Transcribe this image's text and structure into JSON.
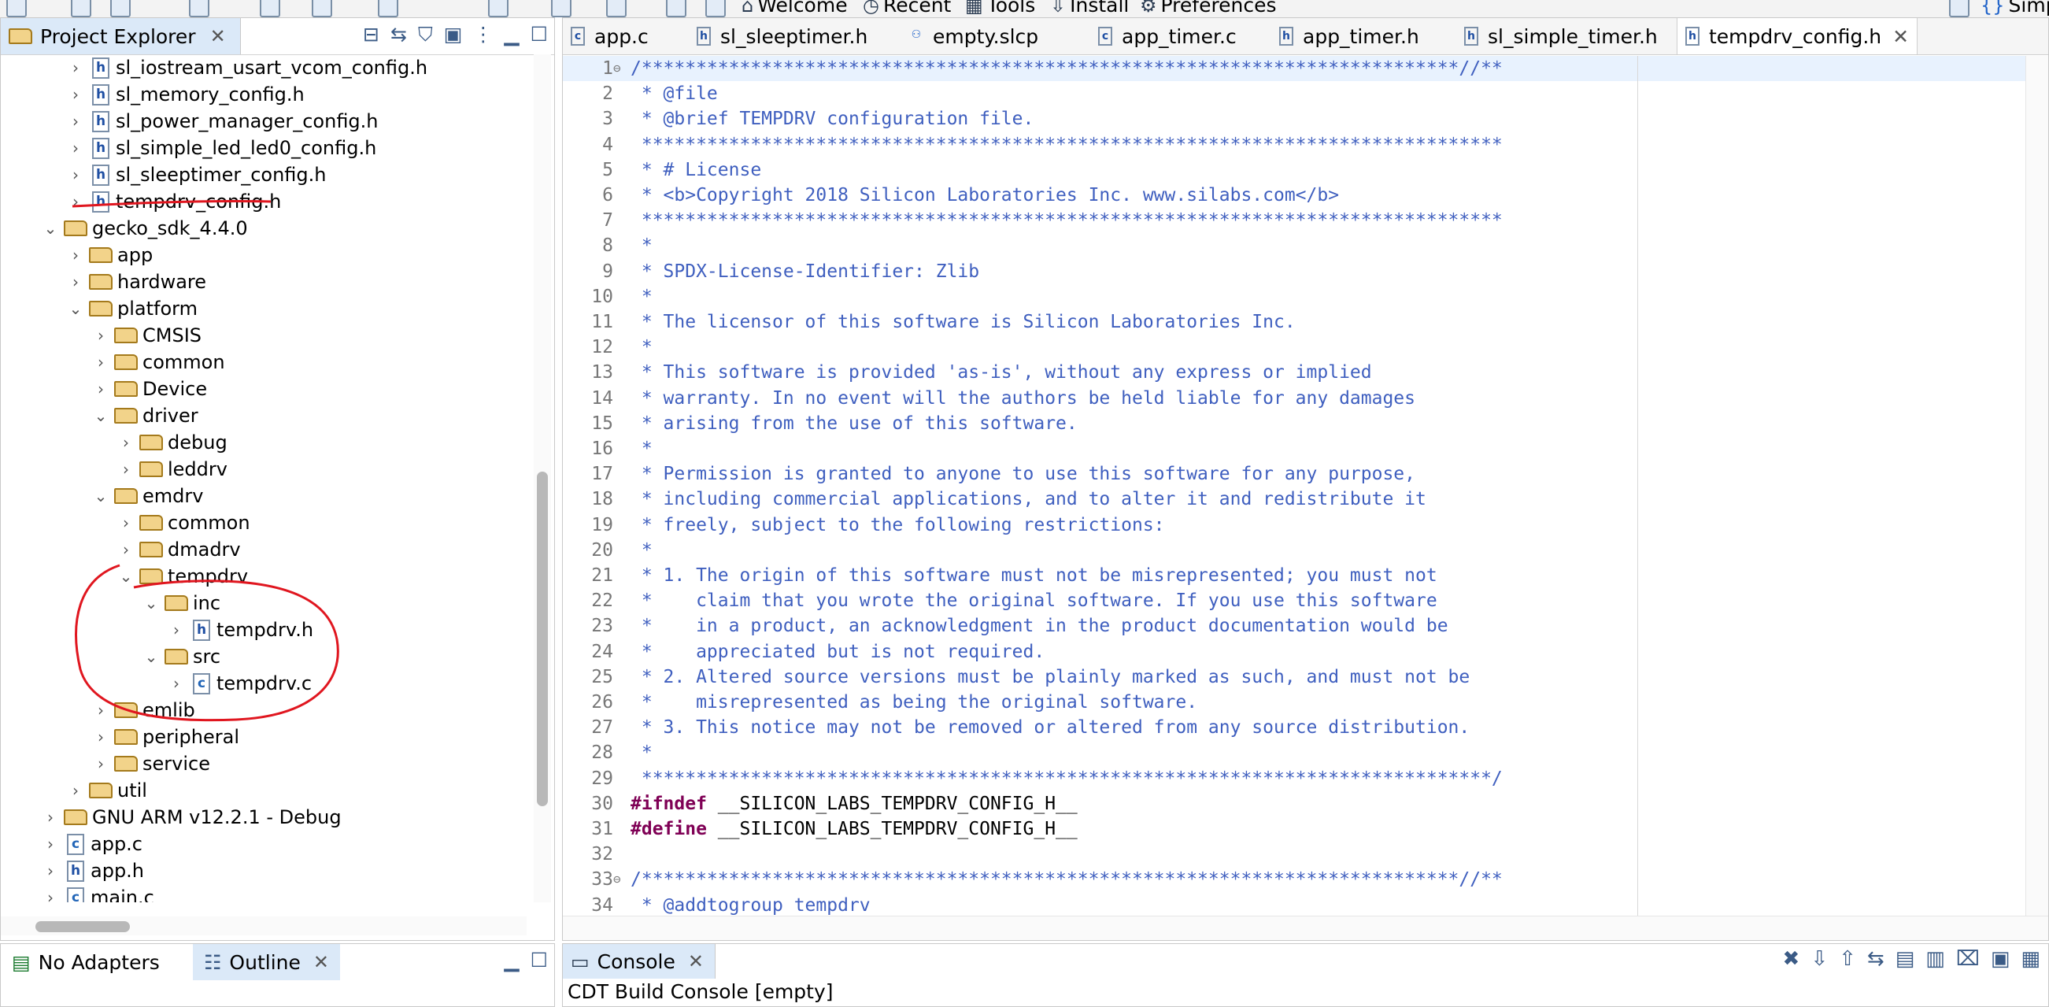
{
  "toolbar": {
    "items": [
      {
        "icon": "home-icon",
        "label": "Welcome"
      },
      {
        "icon": "recent-icon",
        "label": "Recent"
      },
      {
        "icon": "tools-icon",
        "label": "Tools"
      },
      {
        "icon": "install-icon",
        "label": "Install"
      },
      {
        "icon": "gear-icon",
        "label": "Preferences"
      }
    ],
    "perspective_label": "Simp"
  },
  "project_explorer": {
    "title": "Project Explorer",
    "tree": [
      {
        "label": "sl_iostream_usart_vcom_config.h",
        "kind": "h",
        "expanded": false
      },
      {
        "label": "sl_memory_config.h",
        "kind": "h",
        "expanded": false
      },
      {
        "label": "sl_power_manager_config.h",
        "kind": "h",
        "expanded": false
      },
      {
        "label": "sl_simple_led_led0_config.h",
        "kind": "h",
        "expanded": false
      },
      {
        "label": "sl_sleeptimer_config.h",
        "kind": "h",
        "expanded": false
      },
      {
        "label": "tempdrv_config.h",
        "kind": "h",
        "expanded": false
      },
      {
        "label": "gecko_sdk_4.4.0",
        "kind": "folder",
        "expanded": true
      },
      {
        "label": "app",
        "kind": "folder",
        "expanded": false
      },
      {
        "label": "hardware",
        "kind": "folder",
        "expanded": false
      },
      {
        "label": "platform",
        "kind": "folder",
        "expanded": true
      },
      {
        "label": "CMSIS",
        "kind": "folder",
        "expanded": false
      },
      {
        "label": "common",
        "kind": "folder",
        "expanded": false
      },
      {
        "label": "Device",
        "kind": "folder",
        "expanded": false
      },
      {
        "label": "driver",
        "kind": "folder",
        "expanded": true
      },
      {
        "label": "debug",
        "kind": "folder",
        "expanded": false
      },
      {
        "label": "leddrv",
        "kind": "folder",
        "expanded": false
      },
      {
        "label": "emdrv",
        "kind": "folder",
        "expanded": true
      },
      {
        "label": "common",
        "kind": "folder",
        "expanded": false
      },
      {
        "label": "dmadrv",
        "kind": "folder",
        "expanded": false
      },
      {
        "label": "tempdrv",
        "kind": "folder",
        "expanded": true
      },
      {
        "label": "inc",
        "kind": "folder",
        "expanded": true
      },
      {
        "label": "tempdrv.h",
        "kind": "h",
        "expanded": false
      },
      {
        "label": "src",
        "kind": "folder",
        "expanded": true
      },
      {
        "label": "tempdrv.c",
        "kind": "c",
        "expanded": false
      },
      {
        "label": "emlib",
        "kind": "folder",
        "expanded": false
      },
      {
        "label": "peripheral",
        "kind": "folder",
        "expanded": false
      },
      {
        "label": "service",
        "kind": "folder",
        "expanded": false
      },
      {
        "label": "util",
        "kind": "folder",
        "expanded": false
      },
      {
        "label": "GNU ARM v12.2.1 - Debug",
        "kind": "folder",
        "expanded": false
      },
      {
        "label": "app.c",
        "kind": "c",
        "expanded": false
      },
      {
        "label": "app.h",
        "kind": "h",
        "expanded": false
      },
      {
        "label": "main.c",
        "kind": "c",
        "expanded": false
      }
    ]
  },
  "lower_left": {
    "tabs": [
      {
        "icon": "adapter-icon",
        "label": "No Adapters"
      },
      {
        "icon": "outline-icon",
        "label": "Outline"
      }
    ]
  },
  "editor": {
    "tabs": [
      {
        "label": "app.c",
        "kind": "c",
        "active": false
      },
      {
        "label": "sl_sleeptimer.h",
        "kind": "h",
        "active": false
      },
      {
        "label": "empty.slcp",
        "kind": "slcp",
        "active": false
      },
      {
        "label": "app_timer.c",
        "kind": "c",
        "active": false
      },
      {
        "label": "app_timer.h",
        "kind": "h",
        "active": false
      },
      {
        "label": "sl_simple_timer.h",
        "kind": "h",
        "active": false
      },
      {
        "label": "tempdrv_config.h",
        "kind": "h",
        "active": true
      }
    ],
    "lines": [
      {
        "n": "1",
        "fold": "⊖",
        "text": "/***************************************************************************//**",
        "pp": false
      },
      {
        "n": "2",
        "fold": "",
        "text": " * @file",
        "pp": false
      },
      {
        "n": "3",
        "fold": "",
        "text": " * @brief TEMPDRV configuration file.",
        "pp": false
      },
      {
        "n": "4",
        "fold": "",
        "text": " *******************************************************************************",
        "pp": false
      },
      {
        "n": "5",
        "fold": "",
        "text": " * # License",
        "pp": false
      },
      {
        "n": "6",
        "fold": "",
        "text": " * <b>Copyright 2018 Silicon Laboratories Inc. www.silabs.com</b>",
        "pp": false
      },
      {
        "n": "7",
        "fold": "",
        "text": " *******************************************************************************",
        "pp": false
      },
      {
        "n": "8",
        "fold": "",
        "text": " *",
        "pp": false
      },
      {
        "n": "9",
        "fold": "",
        "text": " * SPDX-License-Identifier: Zlib",
        "pp": false
      },
      {
        "n": "10",
        "fold": "",
        "text": " *",
        "pp": false
      },
      {
        "n": "11",
        "fold": "",
        "text": " * The licensor of this software is Silicon Laboratories Inc.",
        "pp": false
      },
      {
        "n": "12",
        "fold": "",
        "text": " *",
        "pp": false
      },
      {
        "n": "13",
        "fold": "",
        "text": " * This software is provided 'as-is', without any express or implied",
        "pp": false
      },
      {
        "n": "14",
        "fold": "",
        "text": " * warranty. In no event will the authors be held liable for any damages",
        "pp": false
      },
      {
        "n": "15",
        "fold": "",
        "text": " * arising from the use of this software.",
        "pp": false
      },
      {
        "n": "16",
        "fold": "",
        "text": " *",
        "pp": false
      },
      {
        "n": "17",
        "fold": "",
        "text": " * Permission is granted to anyone to use this software for any purpose,",
        "pp": false
      },
      {
        "n": "18",
        "fold": "",
        "text": " * including commercial applications, and to alter it and redistribute it",
        "pp": false
      },
      {
        "n": "19",
        "fold": "",
        "text": " * freely, subject to the following restrictions:",
        "pp": false
      },
      {
        "n": "20",
        "fold": "",
        "text": " *",
        "pp": false
      },
      {
        "n": "21",
        "fold": "",
        "text": " * 1. The origin of this software must not be misrepresented; you must not",
        "pp": false
      },
      {
        "n": "22",
        "fold": "",
        "text": " *    claim that you wrote the original software. If you use this software",
        "pp": false
      },
      {
        "n": "23",
        "fold": "",
        "text": " *    in a product, an acknowledgment in the product documentation would be",
        "pp": false
      },
      {
        "n": "24",
        "fold": "",
        "text": " *    appreciated but is not required.",
        "pp": false
      },
      {
        "n": "25",
        "fold": "",
        "text": " * 2. Altered source versions must be plainly marked as such, and must not be",
        "pp": false
      },
      {
        "n": "26",
        "fold": "",
        "text": " *    misrepresented as being the original software.",
        "pp": false
      },
      {
        "n": "27",
        "fold": "",
        "text": " * 3. This notice may not be removed or altered from any source distribution.",
        "pp": false
      },
      {
        "n": "28",
        "fold": "",
        "text": " *",
        "pp": false
      },
      {
        "n": "29",
        "fold": "",
        "text": " ******************************************************************************/",
        "pp": false
      },
      {
        "n": "30",
        "fold": "",
        "text": "#ifndef __SILICON_LABS_TEMPDRV_CONFIG_H__",
        "pp": true
      },
      {
        "n": "31",
        "fold": "",
        "text": "#define __SILICON_LABS_TEMPDRV_CONFIG_H__",
        "pp": true
      },
      {
        "n": "32",
        "fold": "",
        "text": "",
        "pp": false
      },
      {
        "n": "33",
        "fold": "⊖",
        "text": "/***************************************************************************//**",
        "pp": false
      },
      {
        "n": "34",
        "fold": "",
        "text": " * @addtogroup tempdrv",
        "pp": false
      }
    ]
  },
  "console": {
    "tab_label": "Console",
    "content": "CDT Build Console [empty]"
  },
  "colors": {
    "comment": "#3f5fbf",
    "keyword": "#7f0055",
    "active_tab": "#dbe9f8",
    "annotation_red": "#e0161f"
  }
}
